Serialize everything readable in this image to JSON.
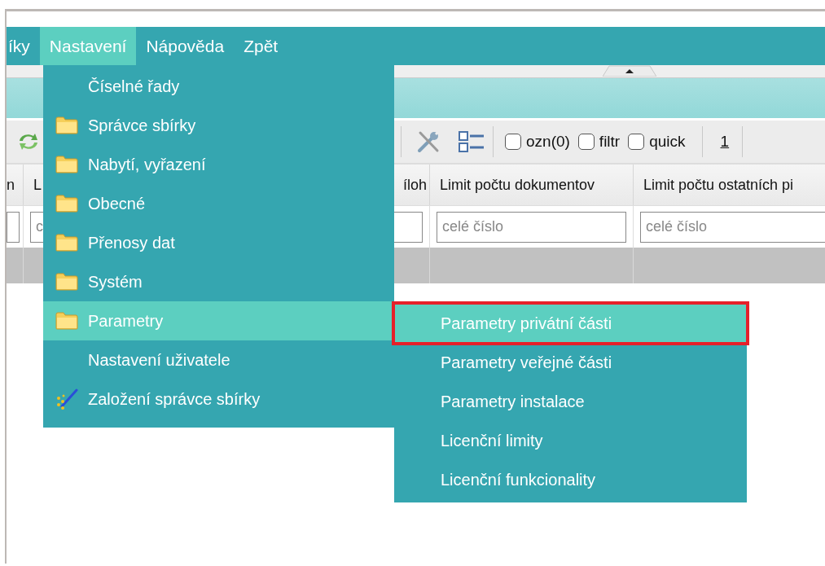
{
  "menubar": {
    "items": [
      {
        "label": "íky",
        "selected": false
      },
      {
        "label": "Nastavení",
        "selected": true
      },
      {
        "label": "Nápověda",
        "selected": false
      },
      {
        "label": "Zpět",
        "selected": false
      }
    ]
  },
  "toolbar": {
    "checkboxes": [
      {
        "label": "ozn(0)",
        "checked": false
      },
      {
        "label": "filtr",
        "checked": false
      },
      {
        "label": "quick",
        "checked": false
      }
    ],
    "page": "1"
  },
  "table": {
    "columns": [
      {
        "header": "n"
      },
      {
        "header": "L",
        "placeholder": "c"
      },
      {
        "header": "íloh"
      },
      {
        "header": "Limit počtu dokumentov",
        "placeholder": "celé číslo"
      },
      {
        "header": "Limit počtu ostatních pi",
        "placeholder": "celé číslo"
      }
    ]
  },
  "dropdown": {
    "items": [
      {
        "label": "Číselné řady",
        "kind": "plain",
        "selected": false
      },
      {
        "label": "Správce sbírky",
        "kind": "folder",
        "selected": false
      },
      {
        "label": "Nabytí, vyřazení",
        "kind": "folder",
        "selected": false
      },
      {
        "label": "Obecné",
        "kind": "folder",
        "selected": false
      },
      {
        "label": "Přenosy dat",
        "kind": "folder",
        "selected": false
      },
      {
        "label": "Systém",
        "kind": "folder",
        "selected": false
      },
      {
        "label": "Parametry",
        "kind": "folder",
        "selected": true
      },
      {
        "label": "Nastavení uživatele",
        "kind": "plain",
        "selected": false
      },
      {
        "label": "Založení správce sbírky",
        "kind": "wand",
        "selected": false
      }
    ]
  },
  "submenu": {
    "items": [
      {
        "label": "Parametry privátní části",
        "selected": true,
        "outlined": true
      },
      {
        "label": "Parametry veřejné části",
        "selected": false,
        "outlined": false
      },
      {
        "label": "Parametry instalace",
        "selected": false,
        "outlined": false
      },
      {
        "label": "Licenční limity",
        "selected": false,
        "outlined": false
      },
      {
        "label": "Licenční funkcionality",
        "selected": false,
        "outlined": false
      }
    ]
  }
}
